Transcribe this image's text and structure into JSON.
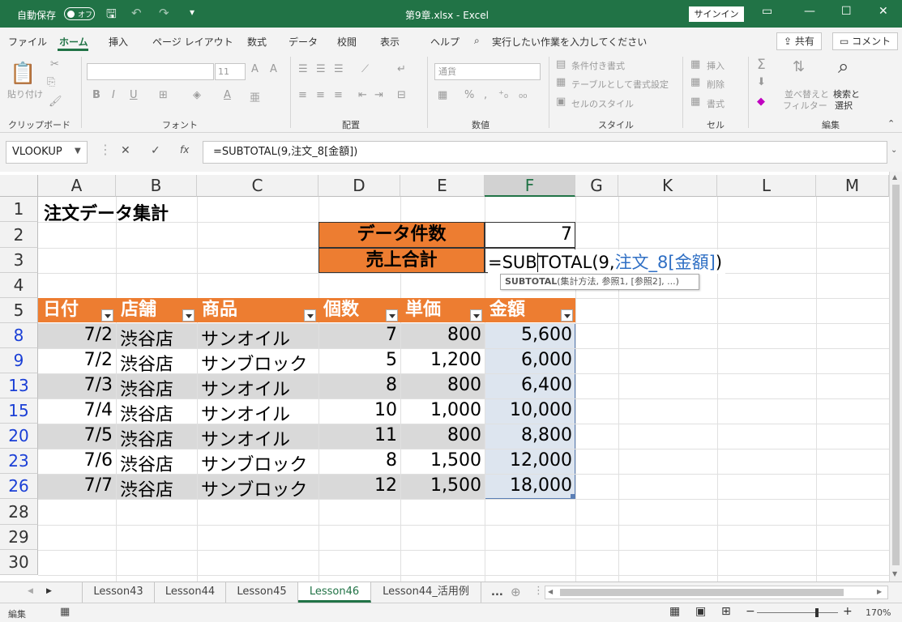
{
  "titlebar": {
    "autosave_label": "自動保存",
    "autosave_state": "オフ",
    "filename": "第9章.xlsx - Excel",
    "signin": "サインイン"
  },
  "tabs": [
    "ファイル",
    "ホーム",
    "挿入",
    "ページ レイアウト",
    "数式",
    "データ",
    "校閲",
    "表示",
    "ヘルプ"
  ],
  "active_tab": "ホーム",
  "tell_me": "実行したい作業を入力してください",
  "share": "共有",
  "comment": "コメント",
  "ribbon": {
    "paste": "貼り付け",
    "font_size": "11",
    "number_format": "通貨",
    "conditional_format": "条件付き書式",
    "format_as_table": "テーブルとして書式設定",
    "cell_styles": "セルのスタイル",
    "insert": "挿入",
    "delete": "削除",
    "format": "書式",
    "sort_filter_1": "並べ替えと",
    "sort_filter_2": "フィルター",
    "find_select_1": "検索と",
    "find_select_2": "選択",
    "groups": {
      "clipboard": "クリップボード",
      "font": "フォント",
      "alignment": "配置",
      "number": "数値",
      "styles": "スタイル",
      "cells": "セル",
      "editing": "編集"
    }
  },
  "formula_bar": {
    "name_box": "VLOOKUP",
    "formula": "=SUBTOTAL(9,注文_8[金額])"
  },
  "columns": [
    "A",
    "B",
    "C",
    "D",
    "E",
    "F",
    "G",
    "K",
    "L",
    "M"
  ],
  "rows": [
    "1",
    "2",
    "3",
    "4",
    "5",
    "8",
    "9",
    "13",
    "15",
    "20",
    "23",
    "26",
    "28",
    "29",
    "30"
  ],
  "sheet": {
    "title": "注文データ集計",
    "count_label": "データ件数",
    "count_value": "7",
    "sum_label": "売上合計",
    "formula_prefix": "=SUB",
    "formula_mid": "TOTAL(9,",
    "formula_ref": "注文_8[金額]",
    "formula_end": ")",
    "tooltip_fn": "SUBTOTAL",
    "tooltip_args": "(集計方法, 参照1, [参照2], ...)"
  },
  "table": {
    "headers": [
      "日付",
      "店舗",
      "商品",
      "個数",
      "単価",
      "金額"
    ],
    "rows": [
      [
        "7/2",
        "渋谷店",
        "サンオイル",
        "7",
        "800",
        "5,600"
      ],
      [
        "7/2",
        "渋谷店",
        "サンブロック",
        "5",
        "1,200",
        "6,000"
      ],
      [
        "7/3",
        "渋谷店",
        "サンオイル",
        "8",
        "800",
        "6,400"
      ],
      [
        "7/4",
        "渋谷店",
        "サンオイル",
        "10",
        "1,000",
        "10,000"
      ],
      [
        "7/5",
        "渋谷店",
        "サンオイル",
        "11",
        "800",
        "8,800"
      ],
      [
        "7/6",
        "渋谷店",
        "サンブロック",
        "8",
        "1,500",
        "12,000"
      ],
      [
        "7/7",
        "渋谷店",
        "サンブロック",
        "12",
        "1,500",
        "18,000"
      ]
    ]
  },
  "sheet_tabs": [
    "Lesson43",
    "Lesson44",
    "Lesson45",
    "Lesson46",
    "Lesson44_活用例"
  ],
  "active_sheet": "Lesson46",
  "status": {
    "mode": "編集",
    "zoom": "170%"
  }
}
